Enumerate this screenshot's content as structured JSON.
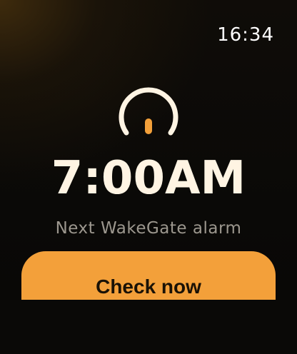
{
  "status_bar": {
    "time": "16:34"
  },
  "alarm": {
    "icon": "power-gauge-icon",
    "time": "7:00AM",
    "subtitle": "Next WakeGate alarm"
  },
  "actions": {
    "check_label": "Check now"
  },
  "colors": {
    "accent": "#f3a03a",
    "text_primary": "#fff4e3",
    "text_secondary": "#9c978e"
  }
}
